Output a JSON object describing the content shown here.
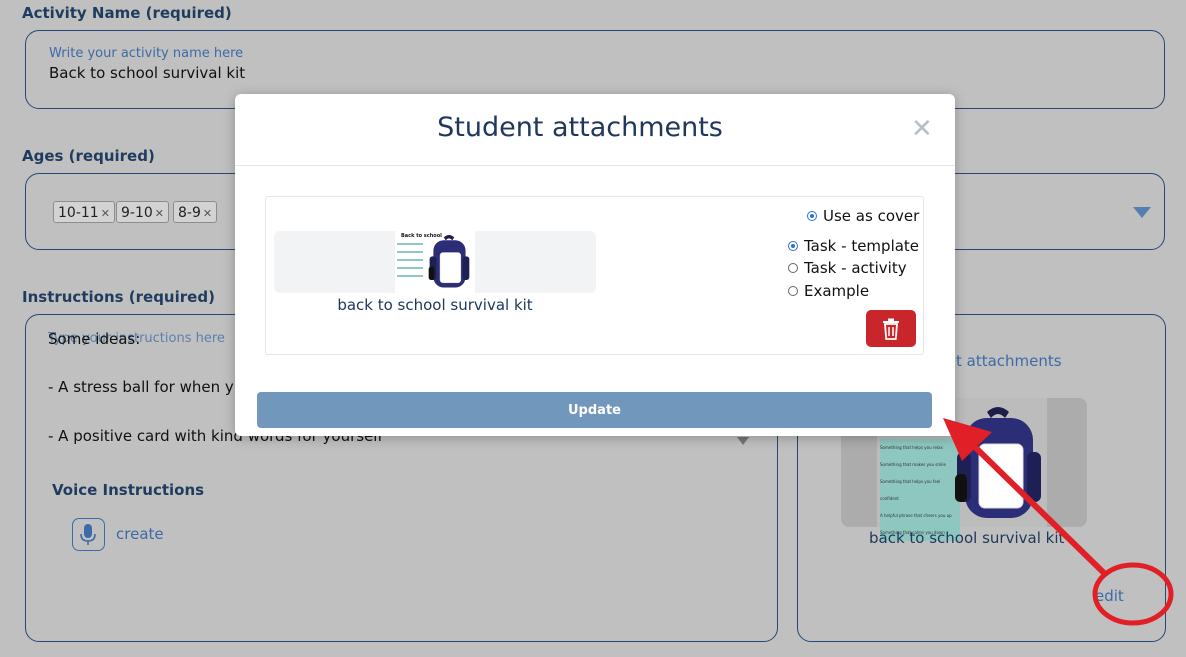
{
  "activity_name": {
    "label": "Activity Name (required)",
    "placeholder": "Write your activity name here",
    "value": "Back to school survival kit"
  },
  "ages": {
    "label": "Ages (required)",
    "tags": [
      "10-11",
      "9-10",
      "8-9"
    ],
    "remove_glyph": "✕"
  },
  "instructions": {
    "label": "Instructions (required)",
    "placeholder": "Type your instructions here",
    "lines": [
      "Some ideas:",
      "- A stress ball for when y",
      "- A positive card with kind words for yourself"
    ],
    "voice_label": "Voice Instructions",
    "create_link": "create"
  },
  "attachments_panel": {
    "title_fragment": "t attachments",
    "file_name": "back to school survival kit",
    "edit_link": "edit",
    "thumb_lines": [
      "Something that helps you relax",
      "Something that makes you smile",
      "Something that helps you feel confident",
      "A helpful phrase that cheers you up",
      "Something that calms you down"
    ]
  },
  "modal": {
    "title": "Student attachments",
    "close_glyph": "✕",
    "attachment_name": "back to school survival kit",
    "thumb_title": "Back to school",
    "options": {
      "use_as_cover": "Use as cover",
      "task_template": "Task - template",
      "task_activity": "Task - activity",
      "example": "Example"
    },
    "update_label": "Update"
  },
  "colors": {
    "annotation_red": "#e01f26",
    "delete_red": "#c9262c",
    "update_blue": "#7297bd",
    "backpack_navy": "#26286b"
  }
}
